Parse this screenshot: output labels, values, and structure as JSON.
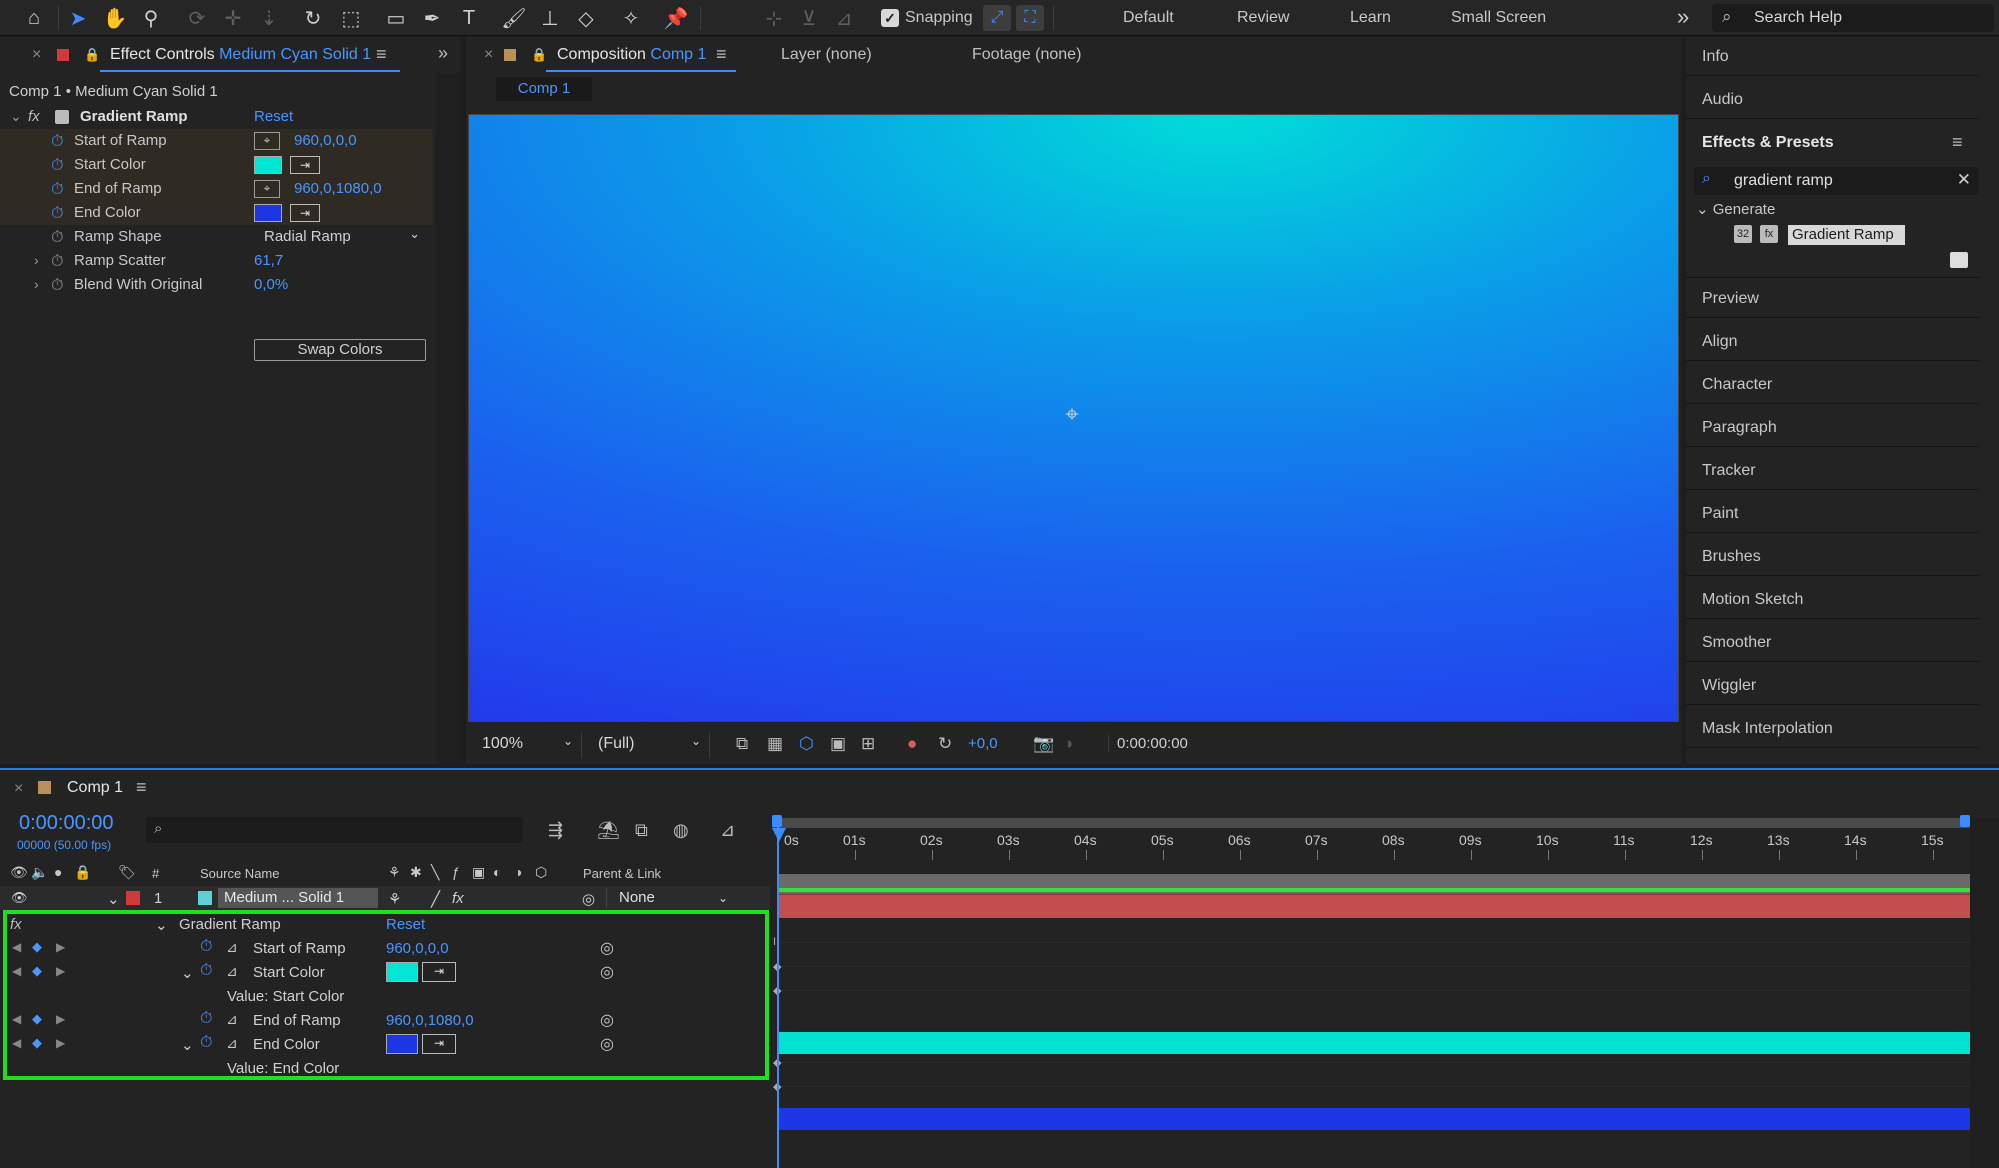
{
  "toolbar": {
    "snapping_label": "Snapping",
    "workspaces": [
      "Default",
      "Review",
      "Learn",
      "Small Screen"
    ],
    "more": "»",
    "search_placeholder": "Search Help"
  },
  "effect_controls": {
    "title": "Effect Controls",
    "title_accent": "Medium Cyan Solid 1",
    "subtitle": "Comp 1 • Medium Cyan Solid 1",
    "effect_name": "Gradient Ramp",
    "reset": "Reset",
    "props": [
      {
        "label": "Start of Ramp",
        "value": "960,0,0,0"
      },
      {
        "label": "Start Color",
        "value": "#00e5d4"
      },
      {
        "label": "End of Ramp",
        "value": "960,0,1080,0"
      },
      {
        "label": "End Color",
        "value": "#1c36e6"
      },
      {
        "label": "Ramp Shape",
        "value": "Radial Ramp"
      },
      {
        "label": "Ramp Scatter",
        "value": "61,7"
      },
      {
        "label": "Blend With Original",
        "value": "0,0%"
      }
    ],
    "swap_button": "Swap Colors"
  },
  "composition": {
    "title": "Composition",
    "title_accent": "Comp 1",
    "tab_layer": "Layer (none)",
    "tab_footage": "Footage (none)",
    "comp_tab": "Comp 1",
    "zoom": "100%",
    "resolution": "(Full)",
    "exposure": "+0,0",
    "timecode": "0:00:00:00"
  },
  "right_panel": {
    "items_top": [
      "Info",
      "Audio"
    ],
    "effects_presets": "Effects & Presets",
    "search_value": "gradient ramp",
    "category": "Generate",
    "result": "Gradient Ramp",
    "items_bottom": [
      "Preview",
      "Align",
      "Character",
      "Paragraph",
      "Tracker",
      "Paint",
      "Brushes",
      "Motion Sketch",
      "Smoother",
      "Wiggler",
      "Mask Interpolation"
    ]
  },
  "timeline": {
    "title": "Comp 1",
    "timecode": "0:00:00:00",
    "fps": "00000 (50.00 fps)",
    "col_source": "Source Name",
    "col_parent": "Parent & Link",
    "col_hash": "#",
    "layer": {
      "index": "1",
      "name": "Medium ... Solid 1",
      "parent": "None"
    },
    "effect_name": "Gradient Ramp",
    "reset": "Reset",
    "props": [
      {
        "label": "Start of Ramp",
        "value": "960,0,0,0"
      },
      {
        "label": "Start Color",
        "value": "#00e5d4"
      },
      {
        "label": "Value: Start Color"
      },
      {
        "label": "End of Ramp",
        "value": "960,0,1080,0"
      },
      {
        "label": "End Color",
        "value": "#1c36e6"
      },
      {
        "label": "Value: End Color"
      }
    ],
    "ruler": [
      "0s",
      "01s",
      "02s",
      "03s",
      "04s",
      "05s",
      "06s",
      "07s",
      "08s",
      "09s",
      "10s",
      "11s",
      "12s",
      "13s",
      "14s",
      "15s"
    ]
  }
}
